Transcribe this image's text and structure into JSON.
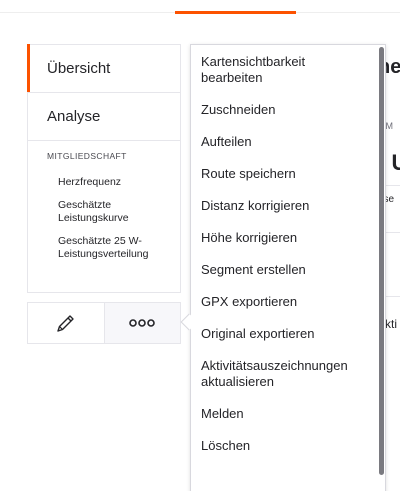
{
  "sidebar": {
    "items": [
      {
        "label": "Übersicht",
        "active": true
      },
      {
        "label": "Analyse",
        "active": false
      }
    ],
    "section_label": "MITGLIEDSCHAFT",
    "sub_items": [
      {
        "label": "Herzfrequenz"
      },
      {
        "label": "Geschätzte Leistungskurve"
      },
      {
        "label": "Geschätzte 25 W-Leistungsverteilung"
      }
    ]
  },
  "actions": {
    "edit_icon": "pencil-icon",
    "more_icon": "ellipsis-icon"
  },
  "menu": {
    "items": [
      {
        "label": "Kartensichtbarkeit bearbeiten"
      },
      {
        "label": "Zuschneiden"
      },
      {
        "label": "Aufteilen"
      },
      {
        "label": "Route speichern"
      },
      {
        "label": "Distanz korrigieren"
      },
      {
        "label": "Höhe korrigieren"
      },
      {
        "label": "Segment erstellen"
      },
      {
        "label": "GPX exportieren"
      },
      {
        "label": "Original exportieren"
      },
      {
        "label": "Aktivitätsauszeichnungen aktualisieren"
      },
      {
        "label": "Melden"
      },
      {
        "label": "Löschen"
      }
    ]
  },
  "background_fragments": {
    "f1": "ne",
    "f2": "n M",
    "f3": ": U",
    "f4": "ese",
    "f5": "kti"
  },
  "colors": {
    "accent": "#fc5200",
    "text": "#242428",
    "border": "#e6e6eb"
  }
}
